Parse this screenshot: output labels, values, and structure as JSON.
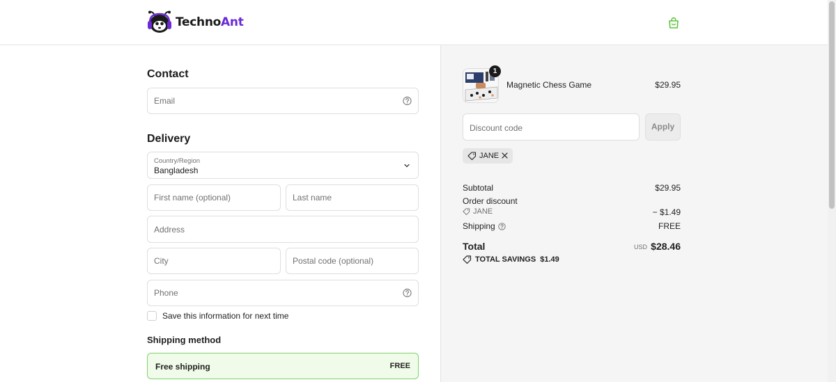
{
  "brand": {
    "name_part1": "Techno",
    "name_part2": "Ant",
    "accent": "#6a2bd6",
    "cart_color": "#5cc53b"
  },
  "contact": {
    "title": "Contact",
    "email_placeholder": "Email"
  },
  "delivery": {
    "title": "Delivery",
    "country_label": "Country/Region",
    "country_value": "Bangladesh",
    "first_name_placeholder": "First name (optional)",
    "last_name_placeholder": "Last name",
    "address_placeholder": "Address",
    "city_placeholder": "City",
    "postal_placeholder": "Postal code (optional)",
    "phone_placeholder": "Phone",
    "save_info_label": "Save this information for next time"
  },
  "shipping_method": {
    "title": "Shipping method",
    "option_name": "Free shipping",
    "option_price": "FREE"
  },
  "summary": {
    "product": {
      "name": "Magnetic Chess Game",
      "price": "$29.95",
      "quantity": "1"
    },
    "discount_placeholder": "Discount code",
    "apply_label": "Apply",
    "applied_code": "JANE",
    "subtotal_label": "Subtotal",
    "subtotal_value": "$29.95",
    "order_discount_label": "Order discount",
    "order_discount_code": "JANE",
    "order_discount_value": "− $1.49",
    "shipping_label": "Shipping",
    "shipping_value": "FREE",
    "total_label": "Total",
    "total_currency": "USD",
    "total_value": "$28.46",
    "savings_label": "TOTAL SAVINGS",
    "savings_value": "$1.49"
  }
}
